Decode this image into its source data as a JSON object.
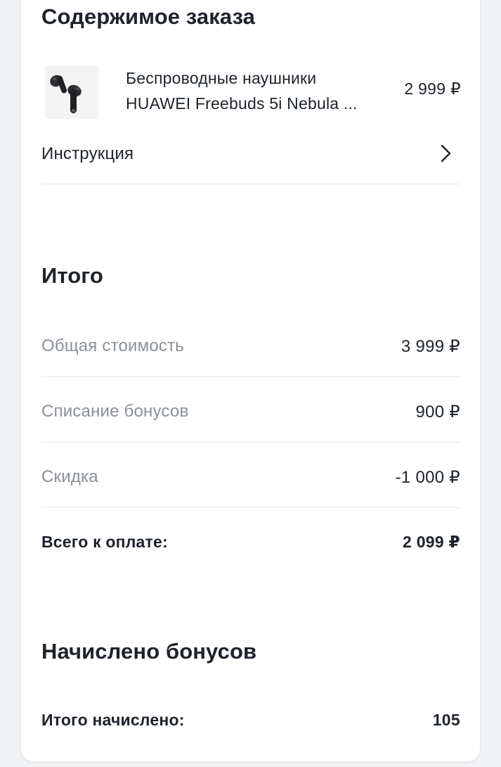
{
  "order_contents": {
    "title": "Содержимое заказа",
    "item": {
      "name_line1": "Беспроводные наушники",
      "name_line2": "HUAWEI Freebuds 5i Nebula ...",
      "price": "2 999 ₽",
      "thumbnail_icon": "earbuds-icon"
    },
    "instruction_label": "Инструкция"
  },
  "totals": {
    "title": "Итого",
    "rows": [
      {
        "label": "Общая стоимость",
        "value": "3 999 ₽"
      },
      {
        "label": "Списание бонусов",
        "value": "900 ₽"
      },
      {
        "label": "Скидка",
        "value": "-1 000 ₽"
      }
    ],
    "total_label": "Всего к оплате:",
    "total_value": "2 099 ₽"
  },
  "bonuses": {
    "title": "Начислено бонусов",
    "total_label": "Итого начислено:",
    "total_value": "105"
  },
  "colors": {
    "card_bg": "#ffffff",
    "page_bg": "#f1f2f4",
    "text_primary": "#1e232a",
    "text_secondary": "#8b9096",
    "divider": "#e6e8eb"
  }
}
